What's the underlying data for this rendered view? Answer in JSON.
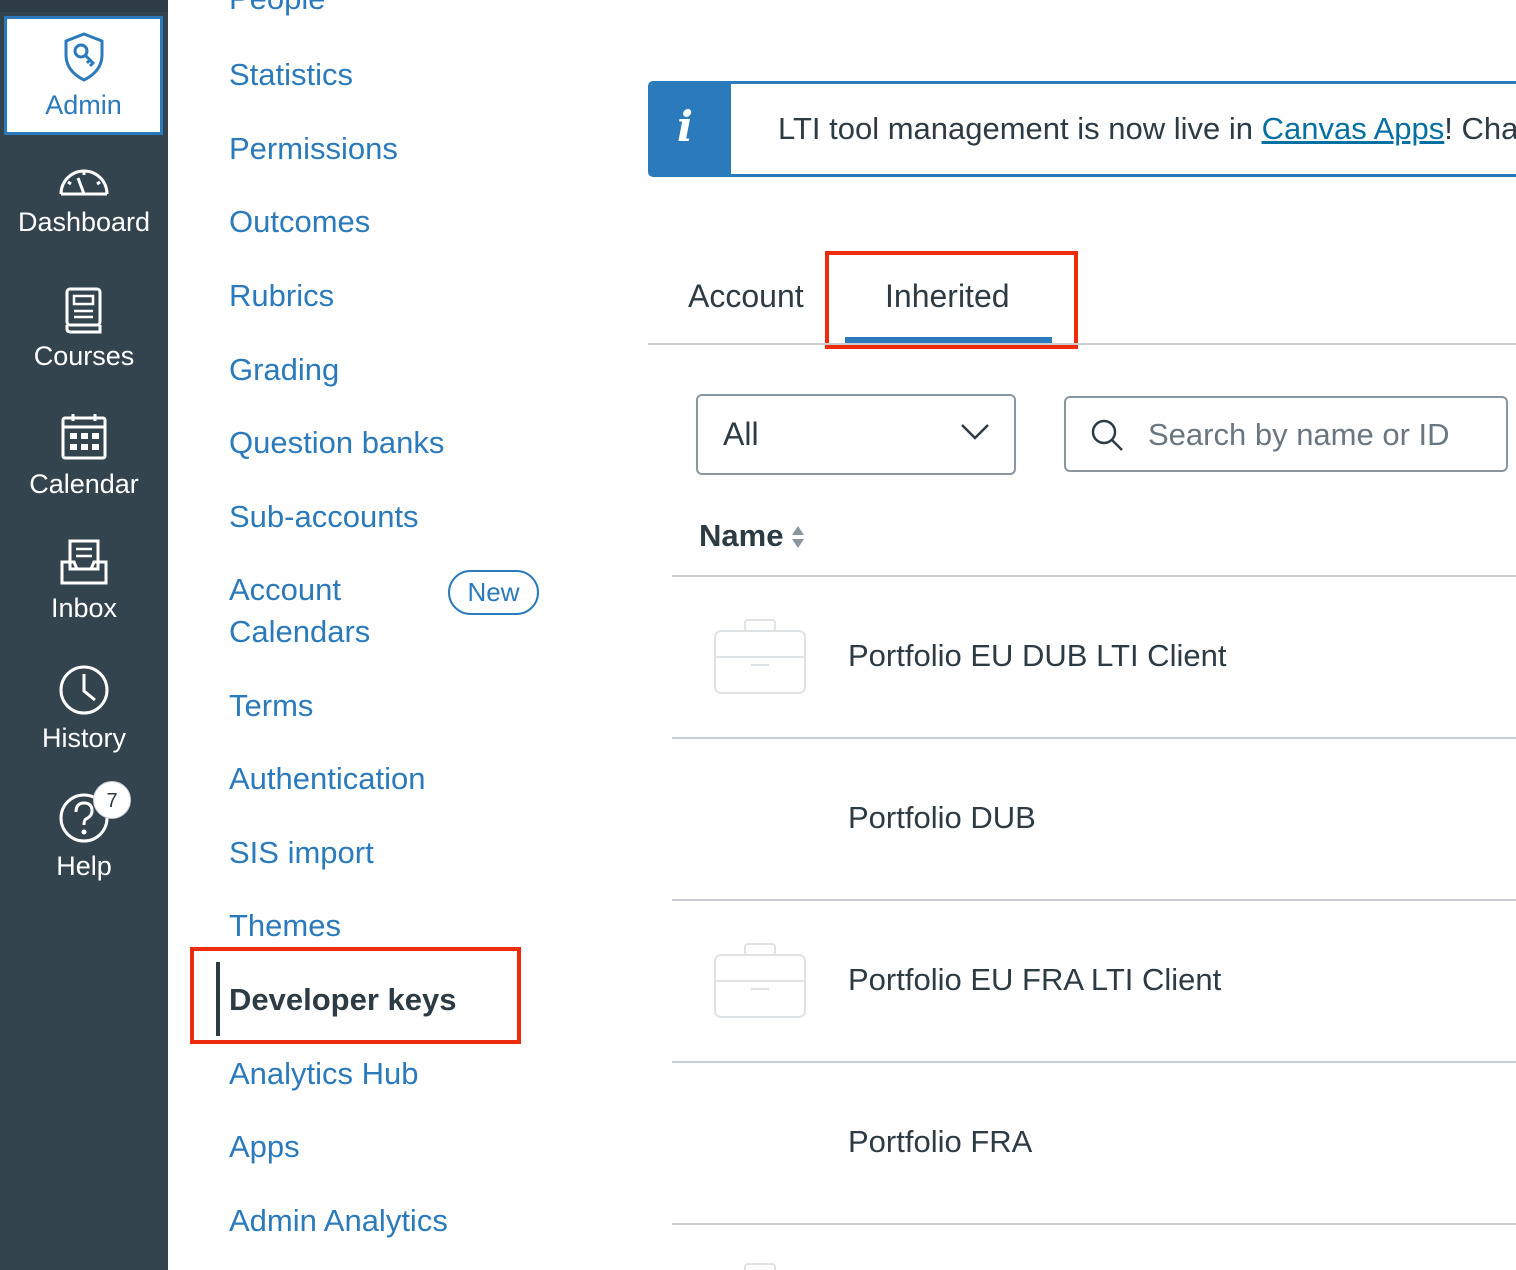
{
  "global_nav": {
    "items": [
      {
        "label": "Admin",
        "icon": "shield-key-icon"
      },
      {
        "label": "Dashboard",
        "icon": "speedometer-icon"
      },
      {
        "label": "Courses",
        "icon": "book-icon"
      },
      {
        "label": "Calendar",
        "icon": "calendar-icon"
      },
      {
        "label": "Inbox",
        "icon": "inbox-icon"
      },
      {
        "label": "History",
        "icon": "clock-icon"
      },
      {
        "label": "Help",
        "icon": "question-icon"
      }
    ],
    "help_badge": "7"
  },
  "account_nav": {
    "items": [
      "People",
      "Statistics",
      "Permissions",
      "Outcomes",
      "Rubrics",
      "Grading",
      "Question banks",
      "Sub-accounts",
      "Account",
      "Calendars",
      "Terms",
      "Authentication",
      "SIS import",
      "Themes",
      "Developer keys",
      "Analytics Hub",
      "Apps",
      "Admin Analytics"
    ],
    "new_badge": "New",
    "active": "Developer keys"
  },
  "alert": {
    "text": "LTI tool management is now live in ",
    "link": "Canvas Apps",
    "suffix": "! Cha"
  },
  "tabs": {
    "account": "Account",
    "inherited": "Inherited",
    "selected": "Inherited"
  },
  "filter": {
    "value": "All",
    "search_placeholder": "Search by name or ID"
  },
  "table": {
    "column": "Name",
    "rows": [
      "Portfolio EU DUB LTI Client",
      "Portfolio DUB",
      "Portfolio EU FRA LTI Client",
      "Portfolio FRA"
    ]
  },
  "colors": {
    "brand": "#2b7abc",
    "nav_bg": "#34444f",
    "highlight": "#ee2b0c"
  }
}
